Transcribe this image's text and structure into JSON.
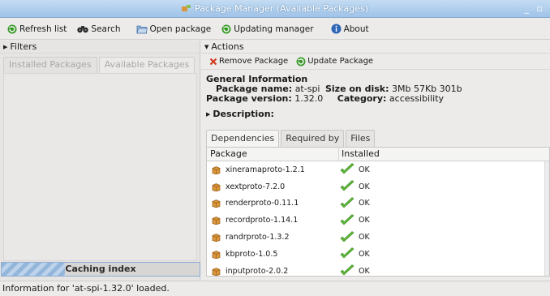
{
  "window": {
    "title": "Package Manager (Available Packages)",
    "controls": "_ ▫"
  },
  "toolbar": {
    "refresh_label": "Refresh list",
    "search_label": "Search",
    "open_label": "Open package",
    "updating_label": "Updating manager",
    "about_label": "About"
  },
  "filters": {
    "label": "Filters"
  },
  "left_tabs": {
    "installed": "Installed Packages",
    "available": "Available Packages"
  },
  "caching": {
    "label": "Caching index"
  },
  "actions": {
    "label": "Actions",
    "remove_label": "Remove Package",
    "update_label": "Update Package"
  },
  "info": {
    "heading": "General Information",
    "name_label": "Package name:",
    "name_value": "at-spi",
    "size_label": "Size on disk:",
    "size_value": "3Mb 57Kb 301b",
    "version_label": "Package version:",
    "version_value": "1.32.0",
    "category_label": "Category:",
    "category_value": "accessibility",
    "description_label": "Description:"
  },
  "detail_tabs": {
    "dependencies": "Dependencies",
    "required_by": "Required by",
    "files": "Files"
  },
  "deps_table": {
    "headers": {
      "package": "Package",
      "installed": "Installed"
    },
    "rows": [
      {
        "package": "xineramaproto-1.2.1",
        "status": "OK"
      },
      {
        "package": "xextproto-7.2.0",
        "status": "OK"
      },
      {
        "package": "renderproto-0.11.1",
        "status": "OK"
      },
      {
        "package": "recordproto-1.14.1",
        "status": "OK"
      },
      {
        "package": "randrproto-1.3.2",
        "status": "OK"
      },
      {
        "package": "kbproto-1.0.5",
        "status": "OK"
      },
      {
        "package": "inputproto-2.0.2",
        "status": "OK"
      }
    ]
  },
  "status_bar": {
    "text": "Information for 'at-spi-1.32.0' loaded."
  },
  "colors": {
    "titlebar": "#a9cbee",
    "green_icon": "#3b9a2a",
    "check": "#5fb83a",
    "package_icon": "#d9963a"
  }
}
